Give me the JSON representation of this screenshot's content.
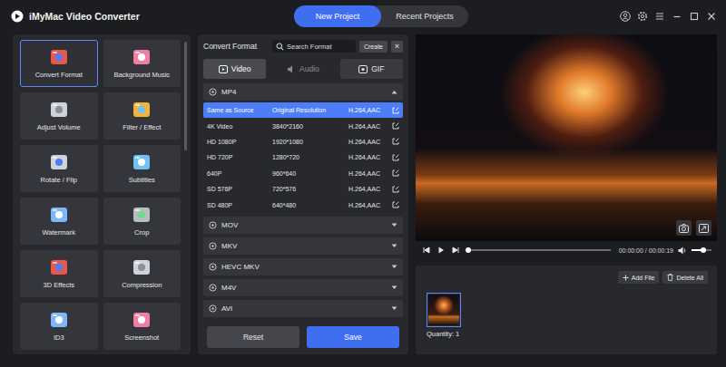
{
  "window": {
    "title": "iMyMac Video Converter"
  },
  "project_tabs": [
    {
      "label": "New Project",
      "selected": true
    },
    {
      "label": "Recent Projects",
      "selected": false
    }
  ],
  "tools": [
    {
      "label": "Convert Format",
      "selected": true
    },
    {
      "label": "Background Music",
      "selected": false
    },
    {
      "label": "Adjust Volume",
      "selected": false
    },
    {
      "label": "Filter / Effect",
      "selected": false
    },
    {
      "label": "Rotate / Flip",
      "selected": false
    },
    {
      "label": "Subtitles",
      "selected": false
    },
    {
      "label": "Watermark",
      "selected": false
    },
    {
      "label": "Crop",
      "selected": false
    },
    {
      "label": "3D Effects",
      "selected": false
    },
    {
      "label": "Compression",
      "selected": false
    },
    {
      "label": "ID3",
      "selected": false
    },
    {
      "label": "Screenshot",
      "selected": false
    }
  ],
  "format_panel": {
    "title": "Convert Format",
    "search_placeholder": "Search Format",
    "create": "Create",
    "close": "×"
  },
  "format_tabs": [
    {
      "label": "Video",
      "selected": true,
      "disabled": false
    },
    {
      "label": "Audio",
      "selected": false,
      "disabled": true
    },
    {
      "label": "GIF",
      "selected": false,
      "disabled": false
    }
  ],
  "groups": [
    {
      "name": "MP4",
      "expanded": true,
      "presets": [
        {
          "name": "Same as Source",
          "resolution": "Original Resolution",
          "codec": "H.264,AAC",
          "selected": true
        },
        {
          "name": "4K Video",
          "resolution": "3840*2160",
          "codec": "H.264,AAC",
          "selected": false
        },
        {
          "name": "HD 1080P",
          "resolution": "1920*1080",
          "codec": "H.264,AAC",
          "selected": false
        },
        {
          "name": "HD 720P",
          "resolution": "1280*720",
          "codec": "H.264,AAC",
          "selected": false
        },
        {
          "name": "640P",
          "resolution": "960*640",
          "codec": "H.264,AAC",
          "selected": false
        },
        {
          "name": "SD 576P",
          "resolution": "720*576",
          "codec": "H.264,AAC",
          "selected": false
        },
        {
          "name": "SD 480P",
          "resolution": "640*480",
          "codec": "H.264,AAC",
          "selected": false
        }
      ]
    },
    {
      "name": "MOV",
      "expanded": false,
      "presets": []
    },
    {
      "name": "MKV",
      "expanded": false,
      "presets": []
    },
    {
      "name": "HEVC MKV",
      "expanded": false,
      "presets": []
    },
    {
      "name": "M4V",
      "expanded": false,
      "presets": []
    },
    {
      "name": "AVI",
      "expanded": false,
      "presets": []
    }
  ],
  "actions": {
    "reset": "Reset",
    "save": "Save"
  },
  "player": {
    "time": "00:00:00 / 00:00:19",
    "progress": 0,
    "volume": 0.6
  },
  "files": {
    "add": "Add File",
    "delete_all": "Delete All",
    "items": [
      {
        "selected": true
      }
    ],
    "quantity": "Quantity: 1"
  }
}
